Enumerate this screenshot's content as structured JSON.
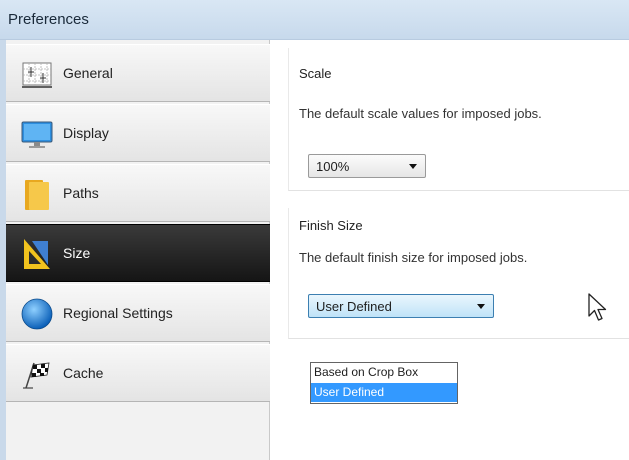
{
  "window": {
    "title": "Preferences"
  },
  "sidebar": {
    "items": [
      {
        "label": "General",
        "icon": "grid-ruler-icon",
        "active": false
      },
      {
        "label": "Display",
        "icon": "monitor-icon",
        "active": false
      },
      {
        "label": "Paths",
        "icon": "folder-icon",
        "active": false
      },
      {
        "label": "Size",
        "icon": "set-square-icon",
        "active": true
      },
      {
        "label": "Regional Settings",
        "icon": "globe-icon",
        "active": false
      },
      {
        "label": "Cache",
        "icon": "checkered-flag-icon",
        "active": false
      }
    ]
  },
  "scale": {
    "title": "Scale",
    "description": "The default scale values for imposed jobs.",
    "value": "100%"
  },
  "finish_size": {
    "title": "Finish Size",
    "description": "The default finish size for imposed jobs.",
    "value": "User Defined",
    "options": [
      "Based on Crop Box",
      "User Defined"
    ],
    "selected_option": "User Defined"
  },
  "colors": {
    "selection": "#3399ff",
    "active_nav": "#1a1a1a",
    "title_bar": "#d2e3f3"
  }
}
